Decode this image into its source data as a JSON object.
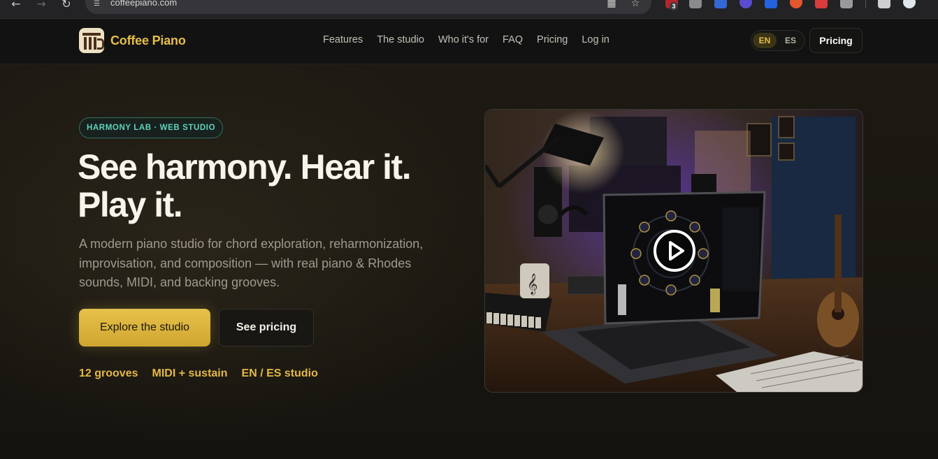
{
  "browser": {
    "url": "coffeepiano.com",
    "extension_badge": "3"
  },
  "header": {
    "brand": "Coffee Piano",
    "nav": [
      "Features",
      "The studio",
      "Who it's for",
      "FAQ",
      "Pricing",
      "Log in"
    ],
    "lang_en": "EN",
    "lang_es": "ES",
    "pricing_button": "Pricing"
  },
  "hero": {
    "tag": "HARMONY LAB · WEB STUDIO",
    "headline_line1": "See harmony. Hear it.",
    "headline_line2": "Play it.",
    "subtext": "A modern piano studio for chord exploration, reharmonization, improvisation, and composition — with real piano & Rhodes sounds, MIDI, and backing grooves.",
    "primary_cta": "Explore the studio",
    "secondary_cta": "See pricing",
    "stats": [
      "12 grooves",
      "MIDI + sustain",
      "EN / ES studio"
    ]
  },
  "colors": {
    "accent": "#e7be49",
    "tag": "#5fd3bd",
    "background": "#17150f"
  }
}
